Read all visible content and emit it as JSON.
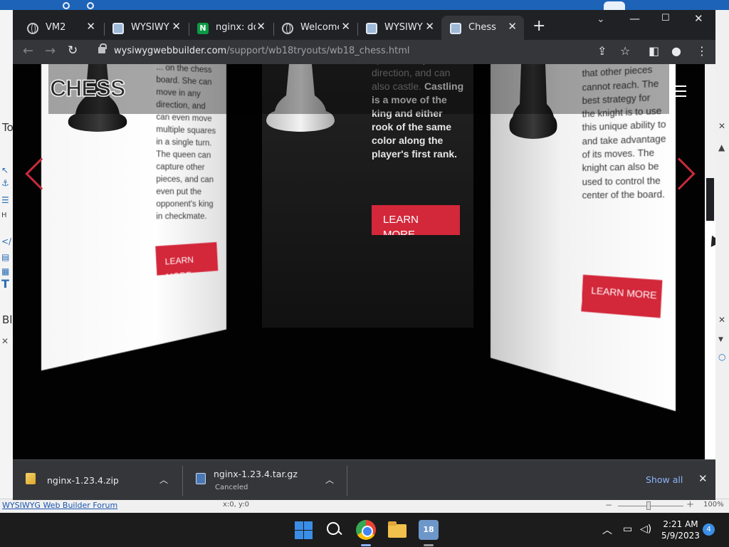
{
  "browser": {
    "tabs": [
      {
        "title": "VM2",
        "icon": "globe-icon"
      },
      {
        "title": "WYSIWYG",
        "icon": "webbuilder-icon"
      },
      {
        "title": "nginx: dov",
        "icon": "nginx-icon",
        "icon_letter": "N"
      },
      {
        "title": "Welcome",
        "icon": "globe-icon"
      },
      {
        "title": "WYSIWYG",
        "icon": "webbuilder-icon"
      },
      {
        "title": "Chess",
        "icon": "webbuilder-icon",
        "active": true
      }
    ],
    "url_host": "wysiwygwebbuilder.com",
    "url_path": "/support/wb18tryouts/wb18_chess.html"
  },
  "page": {
    "logo": "CHESS",
    "left_panel": {
      "text": "... on the chess board. She can move in any direction, and can even move multiple squares in a single turn. The queen can capture other pieces, and can even put the opponent's king in checkmate.",
      "button": "LEARN MORE"
    },
    "center_panel": {
      "text_faded": "space in any direction, and can also castle.",
      "text_main": "Castling is a move of the king and either rook of the same color along the player's first rank.",
      "button_line1": "LEARN",
      "button_line2": "MORE"
    },
    "right_panel": {
      "text": "and reach squares that other pieces cannot reach. The best strategy for the knight is to use this unique ability to and take advantage of its moves. The knight can also be used to control the center of the board.",
      "button": "LEARN MORE"
    },
    "accent_color": "#d3273a"
  },
  "downloads": {
    "items": [
      {
        "name": "nginx-1.23.4.zip",
        "status": ""
      },
      {
        "name": "nginx-1.23.4.tar.gz",
        "status": "Canceled"
      }
    ],
    "show_all": "Show all"
  },
  "background_app": {
    "forum_link": "WYSIWYG Web Builder Forum",
    "coords": "x:0, y:0",
    "zoom": "100%",
    "left_letters": [
      "To",
      "Bl"
    ]
  },
  "taskbar": {
    "time": "2:21 AM",
    "date": "5/9/2023",
    "notifications": "4",
    "webbuilder_badge": "18"
  }
}
